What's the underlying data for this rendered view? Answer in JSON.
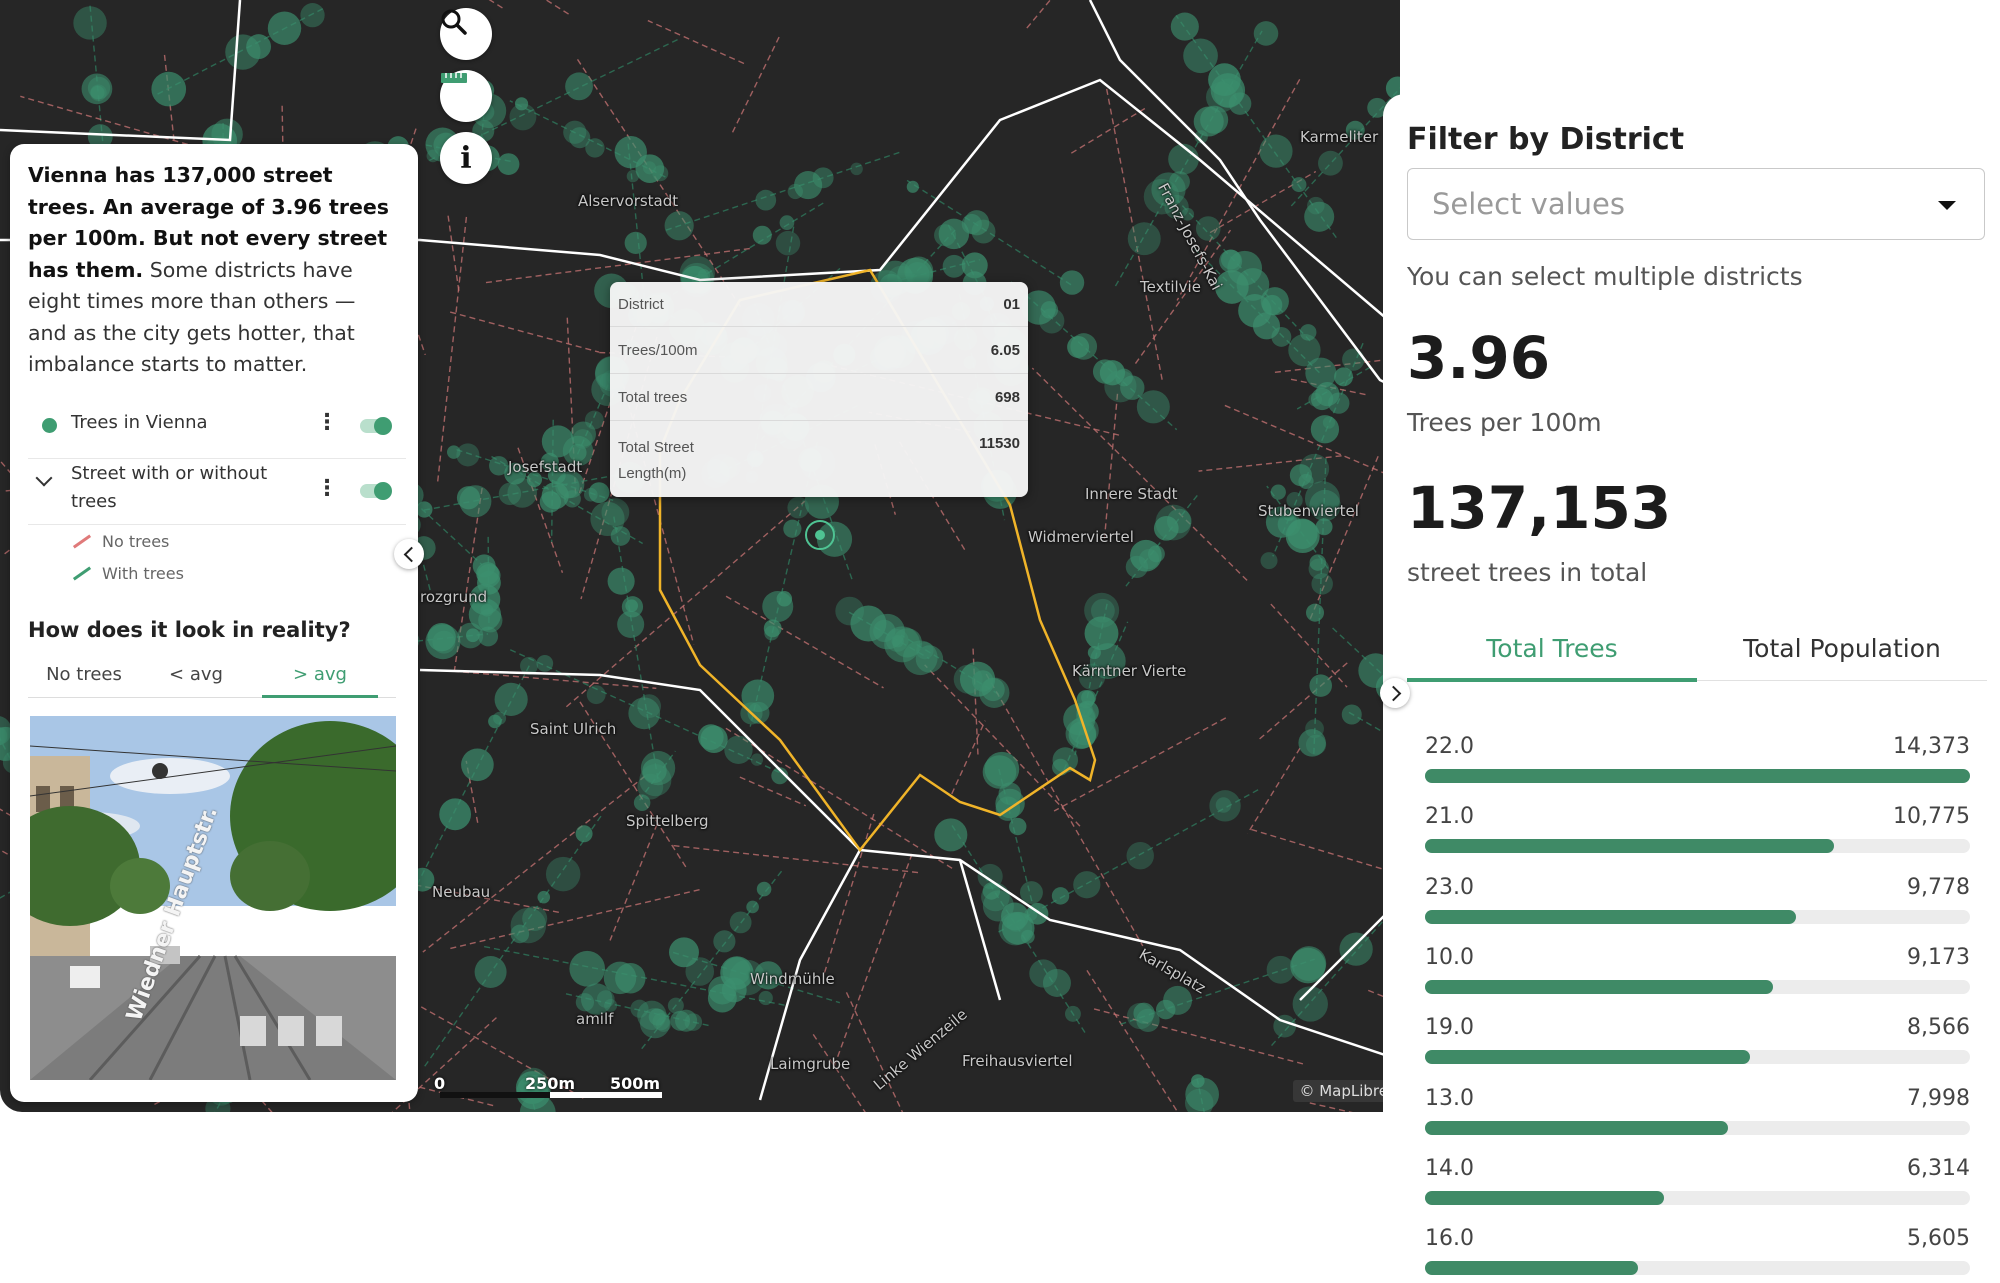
{
  "map": {
    "labels": [
      {
        "text": "Alservorstadt"
      },
      {
        "text": "Karmeliter"
      },
      {
        "text": "Textilvie"
      },
      {
        "text": "Innere Stadt"
      },
      {
        "text": "Stubenviertel"
      },
      {
        "text": "Widmerviertel"
      },
      {
        "text": "Kärntner Vierte"
      },
      {
        "text": "Josefstadt"
      },
      {
        "text": "Saint Ulrich"
      },
      {
        "text": "Spittelberg"
      },
      {
        "text": "Neubau"
      },
      {
        "text": "Windmühle"
      },
      {
        "text": "Laimgrube"
      },
      {
        "text": "Freihausviertel"
      },
      {
        "text": "Franz-Josefs-Kai"
      },
      {
        "text": "Linke Wienzeile"
      },
      {
        "text": "Karlsplatz"
      },
      {
        "text": "rozgrund"
      },
      {
        "text": "amilf"
      }
    ],
    "controls": {
      "search": "search-icon",
      "measure": "ruler-icon",
      "info": "info-icon"
    },
    "scale": {
      "zero": "0",
      "mid": "250m",
      "max": "500m"
    },
    "attribution": "© MapLibre",
    "tooltip": {
      "rows": [
        {
          "label": "District",
          "value": "01"
        },
        {
          "label": "Trees/100m",
          "value": "6.05"
        },
        {
          "label": "Total trees",
          "value": "698"
        },
        {
          "label": "Total Street Length(m)",
          "value": "11530"
        }
      ]
    }
  },
  "left_panel": {
    "intro_bold": "Vienna has 137,000 street trees. An average of 3.96 trees per 100m. But not every street has them.",
    "intro_rest": " Some districts have eight times more than others — and as the city gets hotter, that imbalance starts to matter.",
    "layers": [
      {
        "label": "Trees in Vienna",
        "enabled": true
      },
      {
        "label": "Street with or without trees",
        "enabled": true
      }
    ],
    "legend": [
      {
        "label": "No trees",
        "color": "#e07a7a"
      },
      {
        "label": "With trees",
        "color": "#3f9d72"
      }
    ],
    "reality_title": "How does it look in reality?",
    "reality_tabs": [
      "No trees",
      "< avg",
      "> avg"
    ],
    "active_reality_tab": "> avg",
    "photo_sign": "Wiedner Hauptstr."
  },
  "right_panel": {
    "filter_title": "Filter by District",
    "select_placeholder": "Select values",
    "help_text": "You can select multiple districts",
    "stat1": {
      "value": "3.96",
      "caption": "Trees per 100m"
    },
    "stat2": {
      "value": "137,153",
      "caption": "street trees in total"
    },
    "tabs": [
      "Total Trees",
      "Total Population"
    ],
    "active_tab": "Total Trees",
    "bars": [
      {
        "label": "22.0",
        "value_text": "14,373",
        "value": 14373
      },
      {
        "label": "21.0",
        "value_text": "10,775",
        "value": 10775
      },
      {
        "label": "23.0",
        "value_text": "9,778",
        "value": 9778
      },
      {
        "label": "10.0",
        "value_text": "9,173",
        "value": 9173
      },
      {
        "label": "19.0",
        "value_text": "8,566",
        "value": 8566
      },
      {
        "label": "13.0",
        "value_text": "7,998",
        "value": 7998
      },
      {
        "label": "14.0",
        "value_text": "6,314",
        "value": 6314
      },
      {
        "label": "16.0",
        "value_text": "5,605",
        "value": 5605
      }
    ]
  },
  "colors": {
    "accent": "#3f9d72",
    "bar": "#3f8a66",
    "map_bg": "#262626",
    "tree_dot": "#3c8f6e",
    "district_outline": "#f0b429",
    "street_no_trees": "#c97474"
  }
}
